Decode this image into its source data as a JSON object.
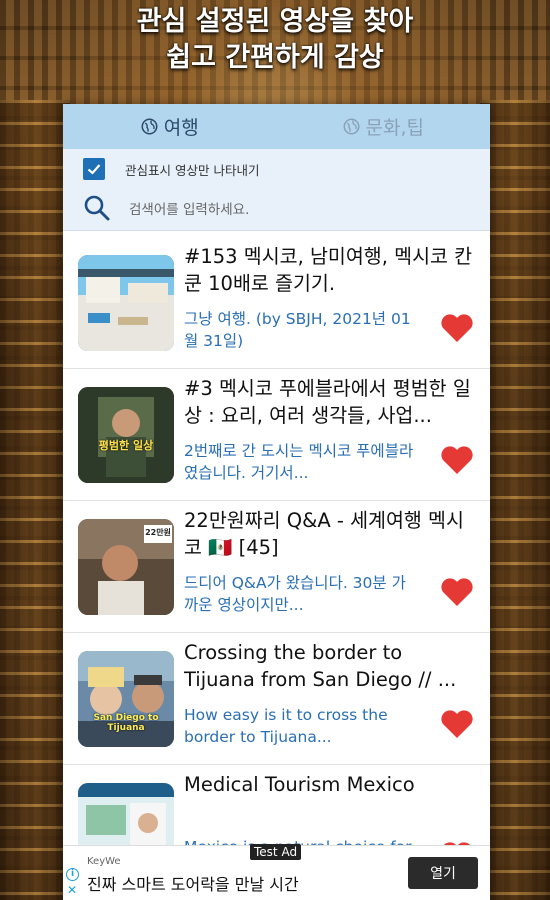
{
  "headline": {
    "line1": "관심 설정된 영상을 찾아",
    "line2": "쉽고 간편하게 감상"
  },
  "tabs": [
    {
      "label": "여행",
      "icon": "globe-icon",
      "active": true
    },
    {
      "label": "문화,팁",
      "icon": "globe-icon",
      "active": false
    }
  ],
  "filter": {
    "label": "관심표시 영상만 나타내기",
    "checked": true
  },
  "search": {
    "placeholder": "검색어를 입력하세요."
  },
  "videos": [
    {
      "title": "#153 멕시코, 남미여행, 멕시코 칸쿤 10배로 즐기기.",
      "description": "그냥 여행. (by SBJH, 2021년 01월 31일)",
      "favorite": true,
      "thumb_overlay": ""
    },
    {
      "title": "#3 멕시코 푸에블라에서 평범한 일상 : 요리, 여러 생각들, 사업...",
      "description": "2번째로 간 도시는 멕시코 푸에블라였습니다. 거기서...",
      "favorite": true,
      "thumb_overlay": "평범한 일상"
    },
    {
      "title": "22만원짜리 Q&A - 세계여행 멕시코 🇲🇽 [45]",
      "description": "드디어 Q&A가 왔습니다. 30분 가까운 영상이지만...",
      "favorite": true,
      "thumb_overlay": "22만원"
    },
    {
      "title": "Crossing the border to Tijuana from San Diego // ...",
      "description": "How easy is it to cross the border to Tijuana...",
      "favorite": true,
      "thumb_overlay": "San Diego to Tijuana"
    },
    {
      "title": "Medical Tourism Mexico",
      "description": "Mexico is a natural choice for medical",
      "favorite": true,
      "thumb_overlay": ""
    }
  ],
  "ad": {
    "badge": "Test Ad",
    "brand": "KeyWe",
    "text": "진짜 스마트 도어락을 만날 시간",
    "button": "열기"
  },
  "colors": {
    "tab_bar": "#b3d6ef",
    "accent_blue": "#2a6fb4",
    "heart_red": "#e53935"
  }
}
